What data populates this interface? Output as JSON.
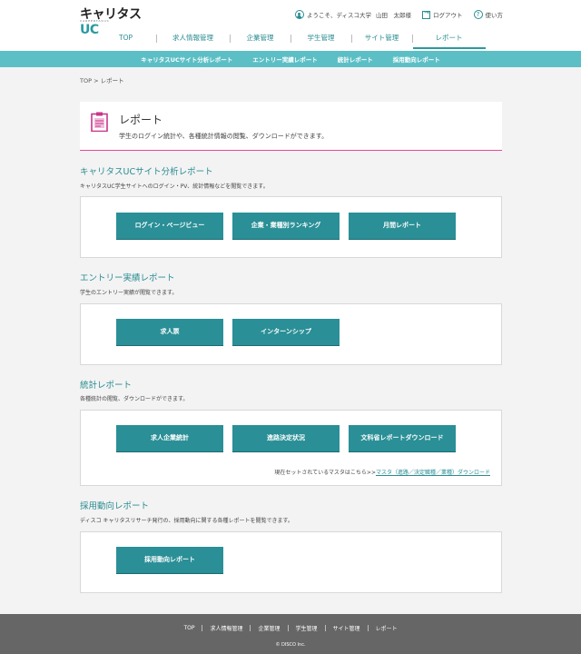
{
  "header": {
    "logo_text": "キャリタス",
    "logo_uc": "UC",
    "logo_sub": "CAREERTASUC",
    "greeting": "ようこそ、ディスコ大学",
    "user_name": "山田　太郎様",
    "logout": "ログアウト",
    "help": "使い方"
  },
  "gnav": [
    "TOP",
    "求人情報管理",
    "企業管理",
    "学生管理",
    "サイト管理",
    "レポート"
  ],
  "subnav": [
    "キャリタスUCサイト分析レポート",
    "エントリー実績レポート",
    "統計レポート",
    "採用動向レポート"
  ],
  "breadcrumb": "TOP > レポート",
  "page": {
    "title": "レポート",
    "desc": "学生のログイン統計や、各種統計情報の閲覧、ダウンロードができます。"
  },
  "sections": {
    "site_analysis": {
      "title": "キャリタスUCサイト分析レポート",
      "desc": "キャリタスUC学生サイトへのログイン・PV、統計情報などを閲覧できます。",
      "buttons": [
        "ログイン・ページビュー",
        "企業・業種別ランキング",
        "月間レポート"
      ]
    },
    "entry": {
      "title": "エントリー実績レポート",
      "desc": "学生のエントリー実績が閲覧できます。",
      "buttons": [
        "求人票",
        "インターンシップ"
      ]
    },
    "stats": {
      "title": "統計レポート",
      "desc": "各種統計の閲覧、ダウンロードができます。",
      "buttons": [
        "求人企業統計",
        "進路決定状況",
        "文科省レポートダウンロード"
      ],
      "master_note": "現在セットされているマスタはこちら>>",
      "master_link": "マスタ（進路／決定職種／業種）ダウンロード"
    },
    "recruit": {
      "title": "採用動向レポート",
      "desc": "ディスコ キャリタスリサーチ発行の、採用動向に関する各種レポートを閲覧できます。",
      "buttons": [
        "採用動向レポート"
      ]
    }
  },
  "footer": {
    "links": [
      "TOP",
      "求人情報管理",
      "企業管理",
      "学生管理",
      "サイト管理",
      "レポート"
    ],
    "copyright": "© DISCO Inc."
  },
  "colors": {
    "accent": "#2a8f96",
    "subnav": "#5cbfc5",
    "pink": "#e8479a",
    "footer": "#666666"
  }
}
